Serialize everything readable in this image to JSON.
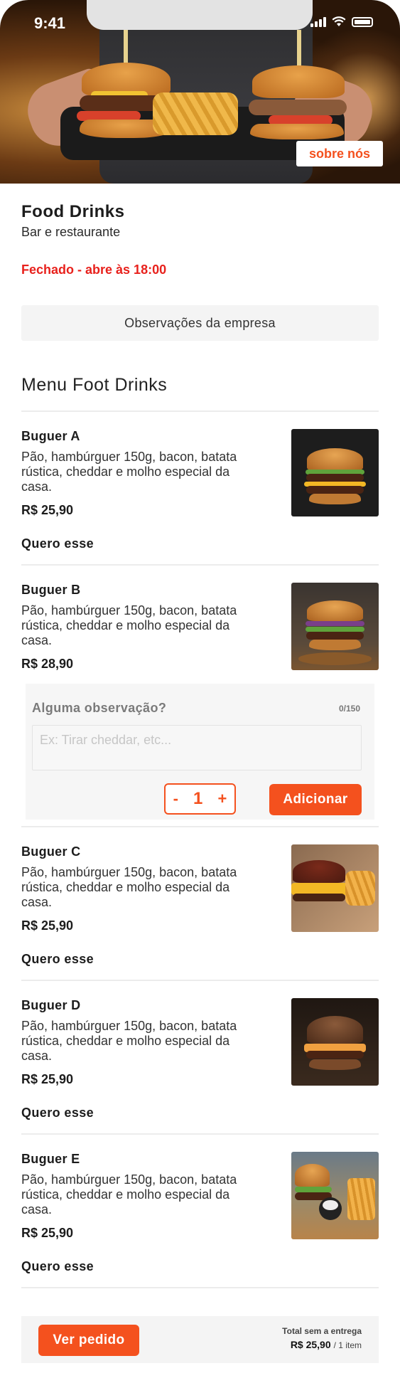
{
  "status_bar": {
    "time": "9:41"
  },
  "hero": {
    "about_label": "sobre nós"
  },
  "company": {
    "name": "Food Drinks",
    "subtitle": "Bar e restaurante",
    "status": "Fechado - abre às 18:00",
    "notes_label": "Observações da empresa"
  },
  "menu": {
    "title": "Menu Foot Drinks",
    "want_label": "Quero esse",
    "items": [
      {
        "name": "Buguer A",
        "description": "Pão, hambúrguer 150g, bacon, batata rústica, cheddar e molho especial da casa.",
        "price": "R$ 25,90"
      },
      {
        "name": "Buguer B",
        "description": "Pão, hambúrguer 150g, bacon, batata rústica, cheddar e molho especial da casa.",
        "price": "R$ 28,90"
      },
      {
        "name": "Buguer C",
        "description": "Pão, hambúrguer 150g, bacon, batata rústica, cheddar e molho especial da casa.",
        "price": "R$ 25,90"
      },
      {
        "name": "Buguer D",
        "description": "Pão, hambúrguer 150g, bacon, batata rústica, cheddar e molho especial da casa.",
        "price": "R$ 25,90"
      },
      {
        "name": "Buguer E",
        "description": "Pão, hambúrguer 150g, bacon, batata rústica, cheddar e molho especial da casa.",
        "price": "R$ 25,90"
      }
    ]
  },
  "add_panel": {
    "label": "Alguma observação?",
    "counter": "0/150",
    "placeholder": "Ex: Tirar cheddar, etc...",
    "minus": "-",
    "quantity": "1",
    "plus": "+",
    "add_label": "Adicionar"
  },
  "footer": {
    "order_label": "Ver pedido",
    "total_label": "Total sem a entrega",
    "total_value": "R$ 25,90",
    "total_items": "/ 1 item"
  },
  "colors": {
    "accent": "#f4511e",
    "closed": "#e8211c"
  }
}
